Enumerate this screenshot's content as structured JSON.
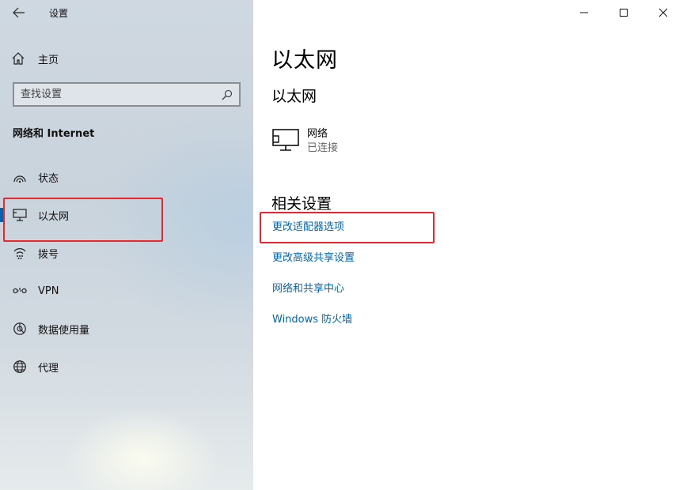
{
  "window": {
    "app_title": "设置"
  },
  "sidebar": {
    "home_label": "主页",
    "search_placeholder": "查找设置",
    "section_title": "网络和 Internet",
    "items": [
      {
        "label": "状态",
        "icon": "status-icon"
      },
      {
        "label": "以太网",
        "icon": "ethernet-icon",
        "selected": true
      },
      {
        "label": "拨号",
        "icon": "dialup-icon"
      },
      {
        "label": "VPN",
        "icon": "vpn-icon"
      },
      {
        "label": "数据使用量",
        "icon": "data-usage-icon"
      },
      {
        "label": "代理",
        "icon": "globe-icon"
      }
    ]
  },
  "main": {
    "page_title": "以太网",
    "sub_title": "以太网",
    "network": {
      "name": "网络",
      "status": "已连接"
    },
    "related_title": "相关设置",
    "links": [
      "更改适配器选项",
      "更改高级共享设置",
      "网络和共享中心",
      "Windows 防火墙"
    ]
  },
  "colors": {
    "accent": "#0063b1",
    "link": "#0066b4",
    "highlight_box": "#e8262b"
  }
}
